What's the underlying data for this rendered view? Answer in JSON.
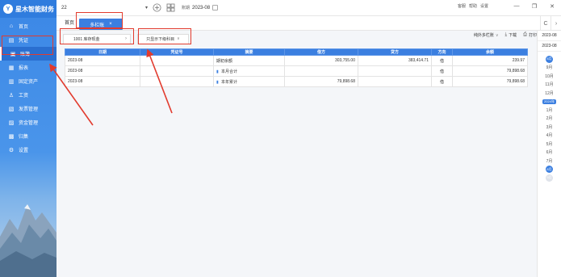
{
  "brand": {
    "logo_glyph": "Y",
    "name": "星木智能财务"
  },
  "sidebar": {
    "items": [
      {
        "label": "首页",
        "icon": "home-icon",
        "glyph": "⌂"
      },
      {
        "label": "凭证",
        "icon": "voucher-icon",
        "glyph": "▤"
      },
      {
        "label": "账簿",
        "icon": "ledger-icon",
        "glyph": "▣",
        "active": true
      },
      {
        "label": "报表",
        "icon": "report-icon",
        "glyph": "▦"
      },
      {
        "label": "固定资产",
        "icon": "asset-icon",
        "glyph": "▥"
      },
      {
        "label": "工资",
        "icon": "salary-icon",
        "glyph": "♙"
      },
      {
        "label": "发票管理",
        "icon": "invoice-icon",
        "glyph": "▧"
      },
      {
        "label": "资金管理",
        "icon": "fund-icon",
        "glyph": "▨"
      },
      {
        "label": "归集",
        "icon": "collect-icon",
        "glyph": "▩"
      },
      {
        "label": "设置",
        "icon": "settings-icon",
        "glyph": "⚙"
      }
    ]
  },
  "topbar": {
    "company": "22",
    "caret": "▾",
    "add_glyph": "+",
    "grid_glyph": "▦",
    "period_label": "账期",
    "period_value": "2023-08",
    "links": [
      "客服",
      "帮助",
      "设置"
    ],
    "window": {
      "minimize": "—",
      "restore": "❐",
      "close": "✕"
    }
  },
  "tabs": {
    "home": "首页",
    "active": "多栏账",
    "close": "×",
    "refresh": "C",
    "more": "›"
  },
  "filters": {
    "subject": "1001 库存现金",
    "subject_chevron": "›",
    "only_show": "只显示下级科目",
    "dropdown_chevron": "∨"
  },
  "toolbar": {
    "settings_label": "纯外多栏账",
    "settings_chevron": "∨",
    "download_label": "下载",
    "download_glyph": "⤓",
    "print_label": "打印",
    "print_glyph": "⎙"
  },
  "table": {
    "columns": [
      "日期",
      "凭证号",
      "摘要",
      "借方",
      "贷方",
      "方向",
      "余额"
    ],
    "rows": [
      {
        "date": "2023-08",
        "voucher": "",
        "summary": "期初余额",
        "debit": "303,755.00",
        "credit": "383,414.71",
        "direction": "借",
        "balance": "239.97",
        "has_icon": false
      },
      {
        "date": "2023-08",
        "voucher": "",
        "summary": "本月合计",
        "debit": "",
        "credit": "",
        "direction": "借",
        "balance": "79,898.68",
        "has_icon": true
      },
      {
        "date": "2023-08",
        "voucher": "",
        "summary": "本年累计",
        "debit": "79,898.68",
        "credit": "",
        "direction": "借",
        "balance": "79,898.68",
        "has_icon": true
      }
    ],
    "sum_icon_glyph": "▮"
  },
  "periods": {
    "start": "2023-08",
    "end": "2023-08",
    "items": [
      {
        "label": "8月",
        "style": "dot-blue"
      },
      {
        "label": "9月",
        "style": ""
      },
      {
        "label": "10月",
        "style": ""
      },
      {
        "label": "11月",
        "style": ""
      },
      {
        "label": "12月",
        "style": ""
      },
      {
        "label": "2024年",
        "style": "year"
      },
      {
        "label": "1月",
        "style": ""
      },
      {
        "label": "2月",
        "style": ""
      },
      {
        "label": "3月",
        "style": ""
      },
      {
        "label": "4月",
        "style": ""
      },
      {
        "label": "5月",
        "style": ""
      },
      {
        "label": "6月",
        "style": ""
      },
      {
        "label": "7月",
        "style": ""
      },
      {
        "label": "8月",
        "style": "dot-blue"
      },
      {
        "label": "9月",
        "style": "dot-grey"
      }
    ]
  },
  "colors": {
    "accent": "#3b7fe0",
    "annotation": "#e23b2e"
  }
}
